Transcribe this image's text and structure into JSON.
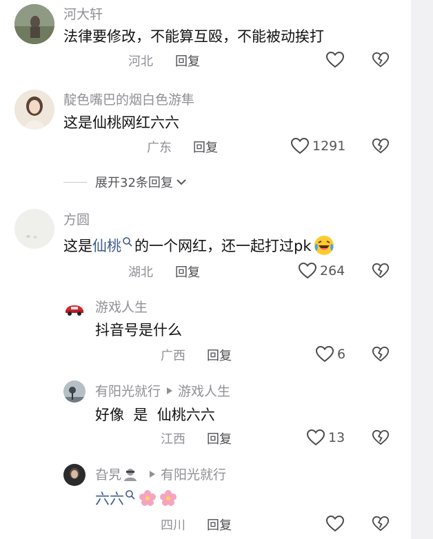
{
  "comments": [
    {
      "username": "河大轩",
      "content": "法律要修改，不能算互殴，不能被动挨打",
      "location": "河北",
      "reply_label": "回复",
      "likes": ""
    },
    {
      "username": "靛色嘴巴的烟白色游隼",
      "content": "这是仙桃网红六六",
      "location": "广东",
      "reply_label": "回复",
      "likes": "1291",
      "expand_label": "展开32条回复"
    },
    {
      "username": "方圆",
      "content_prefix": "这是",
      "content_link": "仙桃",
      "content_suffix": "的一个网红，还一起打过pk",
      "location": "湖北",
      "reply_label": "回复",
      "likes": "264"
    }
  ],
  "replies": [
    {
      "username": "游戏人生",
      "content": "抖音号是什么",
      "location": "广西",
      "reply_label": "回复",
      "likes": "6"
    },
    {
      "username": "有阳光就行",
      "reply_to": "游戏人生",
      "content": "好像  是  仙桃六六",
      "location": "江西",
      "reply_label": "回复",
      "likes": "13"
    },
    {
      "username": "旮旯",
      "reply_to": "有阳光就行",
      "content_link": "六六",
      "location": "四川",
      "reply_label": "回复",
      "likes": ""
    }
  ],
  "avatar3_badge": "游戏人生"
}
